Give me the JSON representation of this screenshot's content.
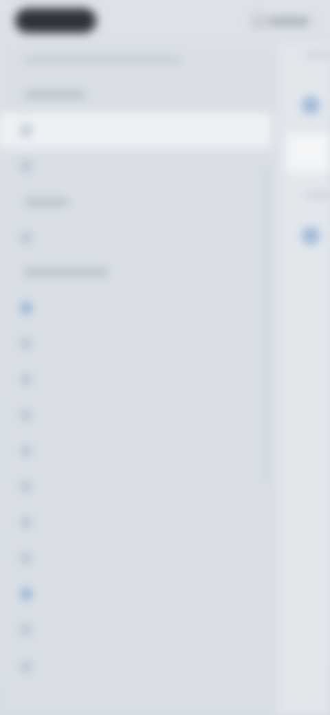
{
  "topbar": {
    "app_pill": "",
    "right_label": ""
  },
  "sidebar": {
    "subtitle": "",
    "sections": [
      {
        "label": "",
        "items": [
          {
            "label": "",
            "active": true,
            "icon": "circle-icon"
          },
          {
            "label": "",
            "active": false,
            "icon": "circle-icon"
          }
        ]
      },
      {
        "label": "",
        "items": [
          {
            "label": "",
            "active": false,
            "icon": "circle-icon"
          }
        ]
      },
      {
        "label": "",
        "items": [
          {
            "label": "",
            "icon": "blue-square-icon"
          },
          {
            "label": "",
            "icon": "square-icon"
          },
          {
            "label": "",
            "icon": "square-icon"
          },
          {
            "label": "",
            "icon": "square-icon"
          },
          {
            "label": "",
            "icon": "square-icon"
          },
          {
            "label": "",
            "icon": "square-icon"
          },
          {
            "label": "",
            "icon": "square-icon"
          },
          {
            "label": "",
            "icon": "square-icon"
          },
          {
            "label": "",
            "icon": "blue-square-icon"
          },
          {
            "label": "",
            "icon": "square-icon"
          },
          {
            "label": "",
            "icon": "square-icon"
          }
        ]
      }
    ]
  },
  "colors": {
    "background": "#d7dde3",
    "sidebar": "#d9dfe5",
    "active_row": "#eef1f4",
    "accent_blue": "#8fb0d6",
    "top_pill": "#2e3338"
  }
}
